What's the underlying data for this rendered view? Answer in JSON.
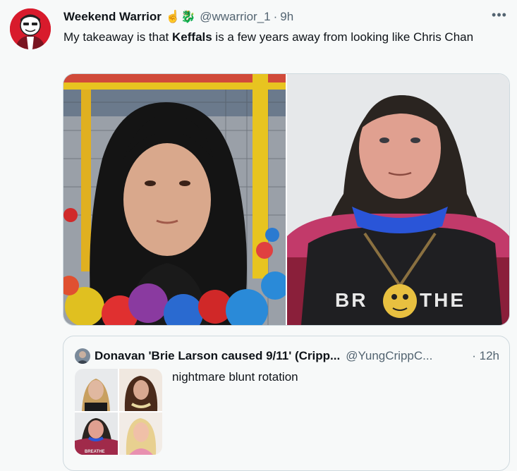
{
  "tweet": {
    "display_name": "Weekend Warrior",
    "emojis": "☝️🐉",
    "handle": "@wwarrior_1",
    "dot": "·",
    "time": "9h",
    "text_before": "My takeaway is that ",
    "text_bold": "Keffals",
    "text_after": " is a few years away from looking like Chris Chan",
    "more_icon": "•••",
    "shirt_text_left": "BR",
    "shirt_text_right": "THE"
  },
  "quote": {
    "display_name": "Donavan 'Brie Larson caused 9/11' (Cripp...",
    "handle": "@YungCrippC...",
    "dot": "·",
    "time": "12h",
    "text": "nightmare blunt rotation",
    "shirt_text": "BREATHE"
  }
}
